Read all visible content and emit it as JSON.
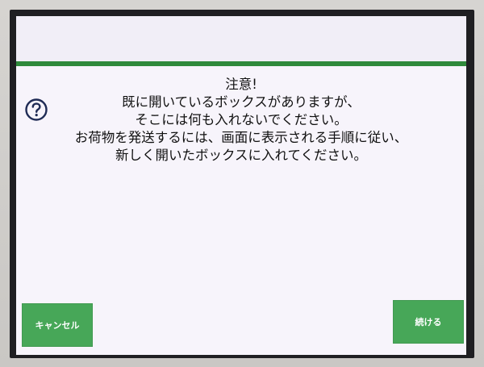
{
  "message": {
    "title": "注意!",
    "lines": [
      "既に開いているボックスがありますが、",
      "そこには何も入れないでください。",
      "お荷物を発送するには、画面に表示される手順に従い、",
      "新しく開いたボックスに入れてください。"
    ]
  },
  "buttons": {
    "cancel_label": "キャンセル",
    "continue_label": "続ける"
  },
  "icons": {
    "help": "question-circle-icon"
  },
  "colors": {
    "accent_bar": "#2f8a3b",
    "button": "#47a758",
    "screen_background": "#f7f4fb",
    "text": "#111111"
  }
}
